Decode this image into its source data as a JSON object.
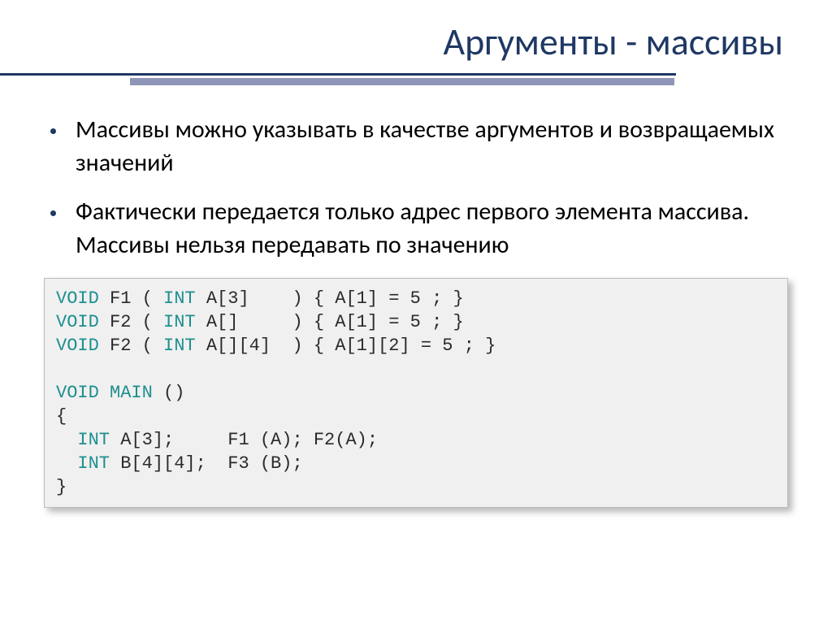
{
  "title": "Аргументы - массивы",
  "bullets": [
    "Массивы можно указывать в качестве аргументов и возвращаемых значений",
    "Фактически передается только адрес первого элемента массива. Массивы нельзя передавать по значению"
  ],
  "code": {
    "kw_void": "VOID",
    "kw_int": "INT",
    "kw_main": "MAIN",
    "line1_a": " F1 ( ",
    "line1_b": " A[3]    ) { A[1] = 5 ; }",
    "line2_a": " F2 ( ",
    "line2_b": " A[]     ) { A[1] = 5 ; }",
    "line3_a": " F2 ( ",
    "line3_b": " A[][4]  ) { A[1][2] = 5 ; }",
    "line5": " ()",
    "line6": "{",
    "line7_a": "  ",
    "line7_b": " A[3];     F1 (A); F2(A);",
    "line8_a": "  ",
    "line8_b": " B[4][4];  F3 (B);",
    "line9": "}"
  }
}
